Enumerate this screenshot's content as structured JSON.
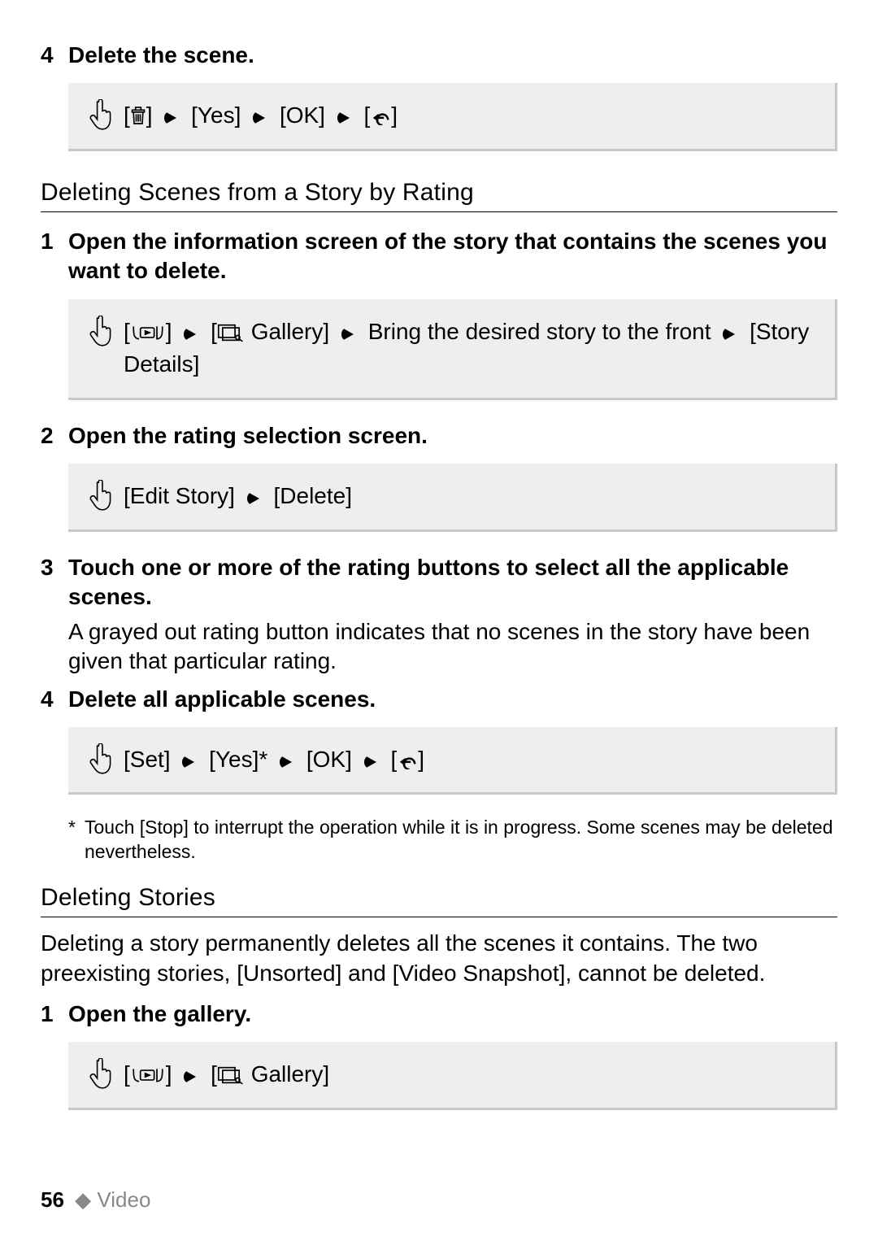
{
  "section1": {
    "step4_num": "4",
    "step4_title": "Delete the scene.",
    "box1": {
      "trash": "[",
      "trash_close": "]",
      "yes": "[Yes]",
      "ok": "[OK]",
      "back": "[",
      "back_close": "]"
    }
  },
  "section2": {
    "heading": "Deleting Scenes from a Story by Rating",
    "step1_num": "1",
    "step1_title": "Open the information screen of the story that contains the scenes you want to delete.",
    "box2": {
      "home_open": "[",
      "home_close": "]",
      "gallery_open": "[",
      "gallery_label": "Gallery]",
      "mid": "Bring the desired story to the front",
      "end": "[Story Details]"
    },
    "step2_num": "2",
    "step2_title": "Open the rating selection screen.",
    "box3": {
      "edit": "[Edit Story]",
      "delete": "[Delete]"
    },
    "step3_num": "3",
    "step3_title": "Touch one or more of the rating buttons to select all the applicable scenes.",
    "step3_body": "A grayed out rating button indicates that no scenes in the story have been given that particular rating.",
    "step4_num": "4",
    "step4_title": "Delete all applicable scenes.",
    "box4": {
      "set": "[Set]",
      "yes": "[Yes]*",
      "ok": "[OK]",
      "back_open": "[",
      "back_close": "]"
    },
    "footnote_ast": "*",
    "footnote": "Touch [Stop] to interrupt the operation while it is in progress. Some scenes may be deleted nevertheless."
  },
  "section3": {
    "heading": "Deleting Stories",
    "intro": "Deleting a story permanently deletes all the scenes it contains. The two preexisting stories, [Unsorted] and [Video Snapshot], cannot be deleted.",
    "step1_num": "1",
    "step1_title": "Open the gallery.",
    "box5": {
      "home_open": "[",
      "home_close": "]",
      "gallery_open": "[",
      "gallery_label": "Gallery]"
    }
  },
  "footer": {
    "page_num": "56",
    "diamond": "◆",
    "section": "Video"
  }
}
